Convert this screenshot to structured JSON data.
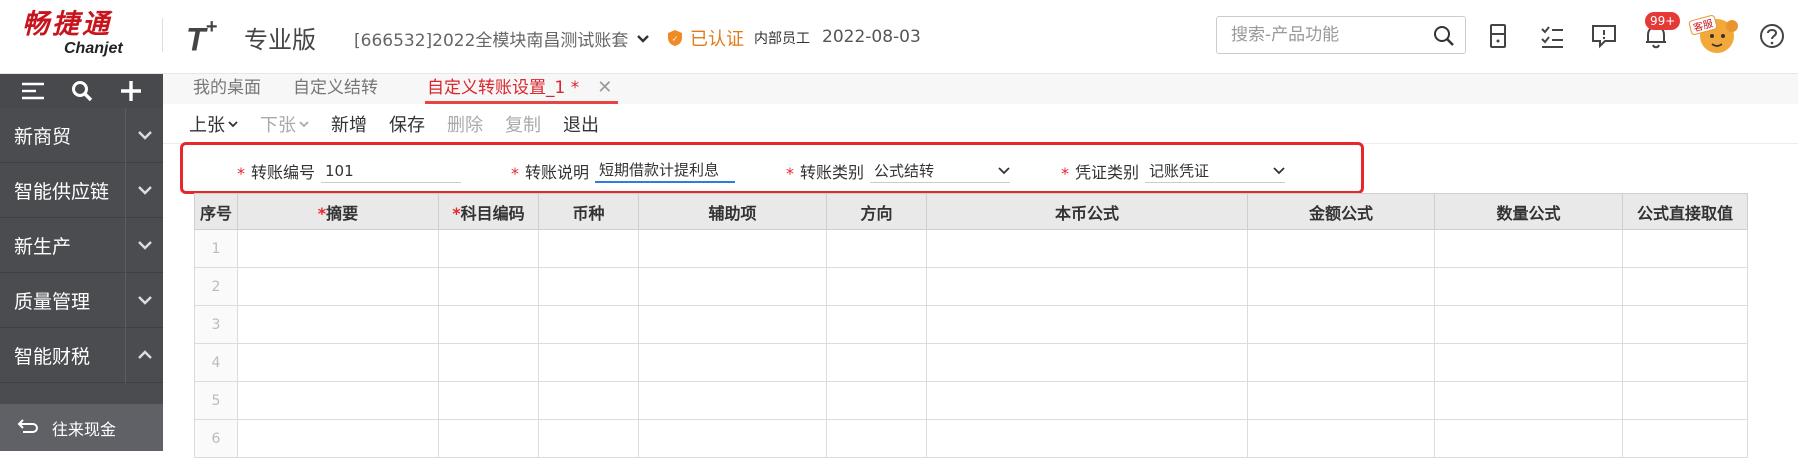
{
  "header": {
    "logo_cn": "畅捷通",
    "logo_en": "Chanjet",
    "product": "T",
    "product_sup": "+",
    "edition": "专业版",
    "account": "[666532]2022全模块南昌测试账套",
    "cert_status": "已认证",
    "role": "内部员工",
    "date": "2022-08-03",
    "search_placeholder": "搜索-产品功能",
    "badge": "99+",
    "avatar_label": "客服",
    "accent": "#c8151d"
  },
  "sidebar": {
    "items": [
      {
        "label": "新商贸",
        "state": "collapsed"
      },
      {
        "label": "智能供应链",
        "state": "collapsed"
      },
      {
        "label": "新生产",
        "state": "collapsed"
      },
      {
        "label": "质量管理",
        "state": "collapsed"
      },
      {
        "label": "智能财税",
        "state": "expanded"
      }
    ],
    "sub_item": "往来现金"
  },
  "tabs": [
    {
      "label": "我的桌面"
    },
    {
      "label": "自定义结转"
    },
    {
      "label": "自定义转账设置_1 *",
      "active": true,
      "close": "✕"
    }
  ],
  "toolbar": {
    "prev": "上张",
    "next": "下张",
    "new": "新增",
    "save": "保存",
    "delete": "删除",
    "copy": "复制",
    "exit": "退出"
  },
  "form": {
    "required_mark": "*",
    "transfer_no_label": "转账编号",
    "transfer_no_value": "101",
    "desc_label": "转账说明",
    "desc_value": "短期借款计提利息",
    "type_label": "转账类别",
    "type_value": "公式结转",
    "voucher_label": "凭证类别",
    "voucher_value": "记账凭证"
  },
  "table": {
    "columns": [
      "序号",
      "摘要",
      "科目编码",
      "币种",
      "辅助项",
      "方向",
      "本币公式",
      "金额公式",
      "数量公式",
      "公式直接取值"
    ],
    "required_columns": [
      1,
      2
    ],
    "rows": [
      "1",
      "2",
      "3",
      "4",
      "5",
      "6"
    ]
  }
}
